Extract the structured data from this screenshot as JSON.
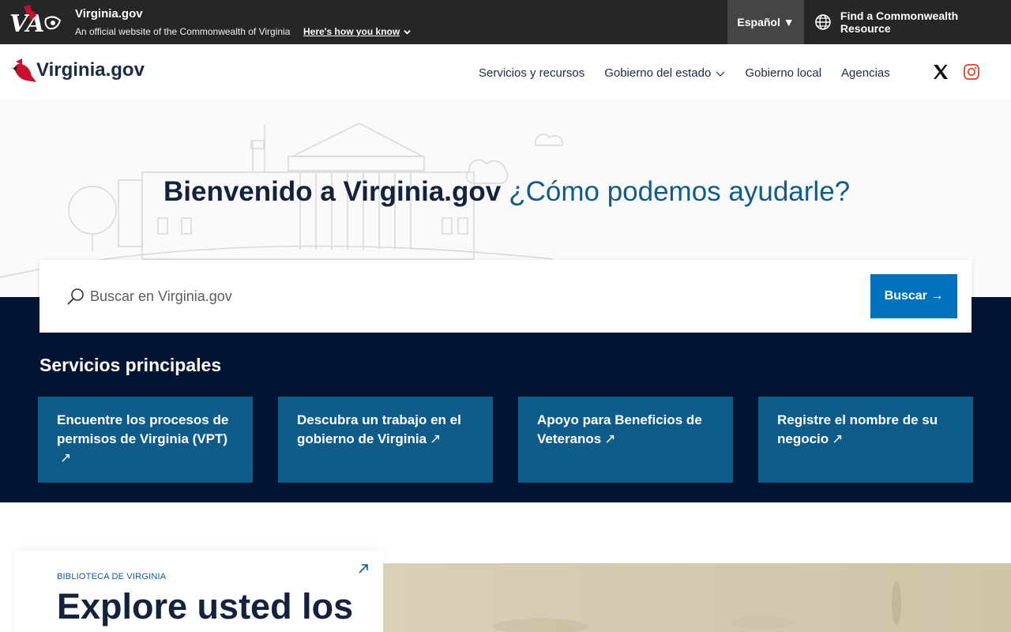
{
  "topbar": {
    "logo_text": "VA",
    "site_name": "Virginia.gov",
    "official_text": "An official website of the Commonwealth of Virginia",
    "how_know_label": "Here's how you know",
    "language_label": "Español ▼",
    "resource_label": "Find a Commonwealth Resource"
  },
  "header": {
    "brand": "Virginia.gov",
    "nav": [
      {
        "label": "Servicios y recursos"
      },
      {
        "label": "Gobierno del estado"
      },
      {
        "label": "Gobierno local"
      },
      {
        "label": "Agencias"
      }
    ]
  },
  "hero": {
    "title_bold": "Bienvenido a Virginia.gov",
    "title_light": "¿Cómo podemos ayudarle?"
  },
  "search": {
    "placeholder": "Buscar en Virginia.gov",
    "button_label": "Buscar →"
  },
  "services": {
    "title": "Servicios principales",
    "cards": [
      {
        "label": "Encuentre los procesos de permisos de Virginia (VPT)",
        "arrow": "↗"
      },
      {
        "label": "Descubra un trabajo en el gobierno de Virginia",
        "arrow": "↗"
      },
      {
        "label": "Apoyo para Beneficios de Veteranos",
        "arrow": "↗"
      },
      {
        "label": "Registre el nombre de su negocio",
        "arrow": "↗"
      }
    ]
  },
  "library": {
    "kicker": "BIBLIOTECA DE VIRGINIA",
    "heading": "Explore usted los"
  },
  "colors": {
    "topbar": "#262626",
    "navy": "#031432",
    "card_blue": "#0f5c8a",
    "button_blue": "#0071bc",
    "instagram": "#e1563a"
  }
}
